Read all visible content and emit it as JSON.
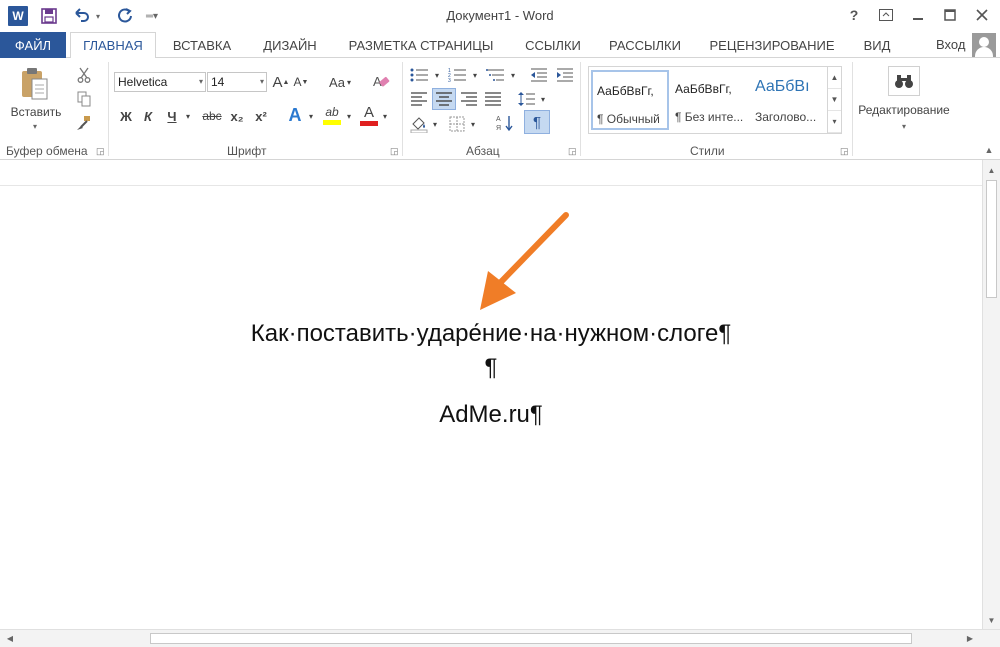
{
  "titlebar": {
    "app_badge": "W",
    "title": "Документ1 - Word",
    "help_label": "?",
    "icons": [
      "word-logo",
      "save-icon",
      "undo-icon",
      "redo-icon",
      "customize-icon",
      "help-icon",
      "ribbon-display-icon",
      "minimize-icon",
      "maximize-icon",
      "close-icon"
    ]
  },
  "tabs": {
    "file": "ФАЙЛ",
    "items": [
      "ГЛАВНАЯ",
      "ВСТАВКА",
      "ДИЗАЙН",
      "РАЗМЕТКА СТРАНИЦЫ",
      "ССЫЛКИ",
      "РАССЫЛКИ",
      "РЕЦЕНЗИРОВАНИЕ",
      "ВИД"
    ],
    "active": "ГЛАВНАЯ",
    "signin": "Вход"
  },
  "ribbon": {
    "clipboard": {
      "paste_label": "Вставить",
      "group_label": "Буфер обмена"
    },
    "font": {
      "group_label": "Шрифт",
      "font_name": "Helvetica",
      "font_size": "14",
      "change_case": "Aa",
      "bold": "Ж",
      "italic": "К",
      "underline": "Ч",
      "strike": "abc",
      "subscript": "x₂",
      "superscript": "x²",
      "grow": "A",
      "shrink": "A",
      "effects": "A",
      "highlight": "ab",
      "color": "A"
    },
    "paragraph": {
      "group_label": "Абзац",
      "pilcrow": "¶"
    },
    "styles": {
      "group_label": "Стили",
      "items": [
        {
          "sample": "АаБбВвГг,",
          "name": "¶ Обычный"
        },
        {
          "sample": "АаБбВвГг,",
          "name": "¶ Без инте..."
        },
        {
          "sample": "АаБбВı",
          "name": "Заголово..."
        }
      ]
    },
    "editing": {
      "label": "Редактирование"
    }
  },
  "document": {
    "line1": "Как·поставить·ударе́ние·на·нужном·слоге¶",
    "line2": "¶",
    "line3": "AdMe.ru¶"
  },
  "colors": {
    "accent": "#2b579a",
    "annotation_arrow": "#f07d27",
    "highlight_yellow": "#ffff00",
    "font_red": "#e02020"
  }
}
